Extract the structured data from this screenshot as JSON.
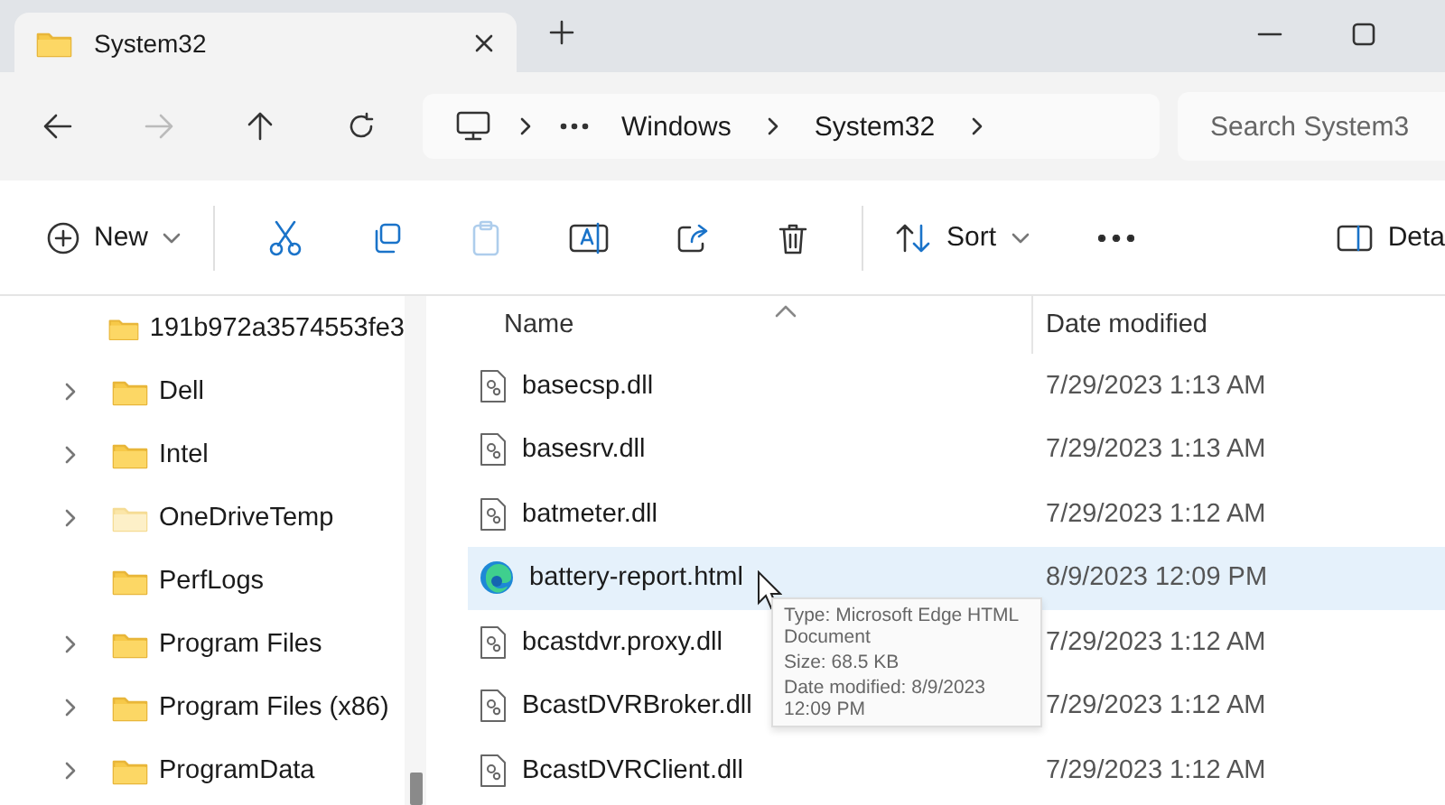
{
  "title_bar": {
    "tab": {
      "title": "System32",
      "selected": true
    }
  },
  "nav_bar": {
    "breadcrumbs": [
      "Windows",
      "System32"
    ],
    "search": {
      "placeholder": "Search System3"
    },
    "forward_disabled": true
  },
  "command_bar": {
    "new_label": "New",
    "sort_label": "Sort",
    "details_label": "Deta",
    "paste_disabled": true
  },
  "sidebar": {
    "items": [
      {
        "label": "191b972a3574553fe3",
        "expandable": false,
        "hidden": false
      },
      {
        "label": "Dell",
        "expandable": true,
        "hidden": false
      },
      {
        "label": "Intel",
        "expandable": true,
        "hidden": false
      },
      {
        "label": "OneDriveTemp",
        "expandable": true,
        "hidden": true
      },
      {
        "label": "PerfLogs",
        "expandable": false,
        "hidden": false
      },
      {
        "label": "Program Files",
        "expandable": true,
        "hidden": false
      },
      {
        "label": "Program Files (x86)",
        "expandable": true,
        "hidden": false
      },
      {
        "label": "ProgramData",
        "expandable": true,
        "hidden": false
      }
    ]
  },
  "file_list": {
    "columns": [
      "Name",
      "Date modified"
    ],
    "rows": [
      {
        "name": "basecsp.dll",
        "date": "7/29/2023 1:13 AM",
        "kind": "dll",
        "selected": false
      },
      {
        "name": "basesrv.dll",
        "date": "7/29/2023 1:13 AM",
        "kind": "dll",
        "selected": false
      },
      {
        "name": "batmeter.dll",
        "date": "7/29/2023 1:12 AM",
        "kind": "dll",
        "selected": false
      },
      {
        "name": "battery-report.html",
        "date": "8/9/2023 12:09 PM",
        "kind": "edge",
        "selected": true
      },
      {
        "name": "bcastdvr.proxy.dll",
        "date": "7/29/2023 1:12 AM",
        "kind": "dll",
        "selected": false
      },
      {
        "name": "BcastDVRBroker.dll",
        "date": "7/29/2023 1:12 AM",
        "kind": "dll",
        "selected": false
      },
      {
        "name": "BcastDVRClient.dll",
        "date": "7/29/2023 1:12 AM",
        "kind": "dll",
        "selected": false
      }
    ],
    "tooltip": [
      "Type: Microsoft Edge HTML Document",
      "Size: 68.5 KB",
      "Date modified: 8/9/2023 12:09 PM"
    ]
  }
}
